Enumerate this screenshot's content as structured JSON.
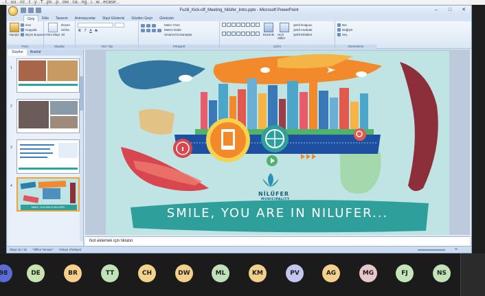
{
  "window": {
    "title": "Fuzili_Kick-off_Meeting_Nilüfer_Intro.pptx - Microsoft PowerPoint",
    "browser_strip": "...t...uu...cc...t...y...T...ps...p...ow...ca...ng...i...w...ecase..."
  },
  "ribbon": {
    "tabs": [
      "Giriş",
      "Ekle",
      "Tasarım",
      "Animasyonlar",
      "Slayt Gösterisi",
      "Gözden Geçir",
      "Görünüm"
    ],
    "active_tab": "Giriş",
    "clipboard": {
      "paste": "Yapıştır",
      "cut": "Kes",
      "copy": "Kopyala",
      "format_painter": "Biçim Boyacısı",
      "label": "Pano"
    },
    "slides": {
      "new_slide": "Yeni Slayt",
      "layout": "Düzen",
      "reset": "Sıfırla",
      "delete": "Sil",
      "label": "Slaytlar"
    },
    "font": {
      "label": "Yazı Tipi",
      "bold": "K",
      "italic": "T",
      "underline": "A",
      "strike": "S"
    },
    "paragraph": {
      "label": "Paragraf",
      "text_direction": "Metin Yönü",
      "align_text": "Metni Hizala",
      "smartart": "SmartArt'a Dönüştür"
    },
    "drawing": {
      "label": "Çizim",
      "arrange": "Düzenle",
      "quick_styles": "Hızlı Stiller",
      "fill": "Şekil Dolgusu",
      "outline": "Şekil Anahattı",
      "effects": "Şekil Efektleri"
    },
    "editing": {
      "label": "Düzenleme",
      "find": "Bul",
      "replace": "Değiştir",
      "select": "Seç"
    }
  },
  "left_pane": {
    "tabs": [
      "Slaytlar",
      "Anahat"
    ],
    "active_tab": "Slaytlar",
    "thumbnails": [
      "1",
      "2",
      "3",
      "4"
    ],
    "selected_thumbnail": "4",
    "thumb4_caption": "SMILE, YOU ARE IN NILUFER..."
  },
  "slide": {
    "title": "SMILE, YOU ARE IN NILUFER...",
    "brand": "NİLÜFER",
    "brand_sub": "MUNICIPALITY"
  },
  "notes": {
    "placeholder": "Not eklemek için tıklatın"
  },
  "status_bar": {
    "slide_counter": "Slayt 15 / 15",
    "theme": "\"Office Teması\"",
    "language": "Türkçe (Türkiye)",
    "zoom": "%"
  },
  "participants": [
    {
      "initials": "98",
      "color": "#5b6bd6"
    },
    {
      "initials": "DE",
      "color": "#c6e3b0"
    },
    {
      "initials": "BR",
      "color": "#f6d08a"
    },
    {
      "initials": "TT",
      "color": "#bfe3b6"
    },
    {
      "initials": "CH",
      "color": "#f3d28e"
    },
    {
      "initials": "DW",
      "color": "#f2d08c"
    },
    {
      "initials": "ML",
      "color": "#bfe0b8"
    },
    {
      "initials": "KM",
      "color": "#f1cf8c"
    },
    {
      "initials": "PV",
      "color": "#c3c7f0"
    },
    {
      "initials": "AG",
      "color": "#f3d08e"
    },
    {
      "initials": "MG",
      "color": "#e8c6cc"
    },
    {
      "initials": "FJ",
      "color": "#c5e4b7"
    },
    {
      "initials": "NS",
      "color": "#c4e2b7"
    }
  ]
}
